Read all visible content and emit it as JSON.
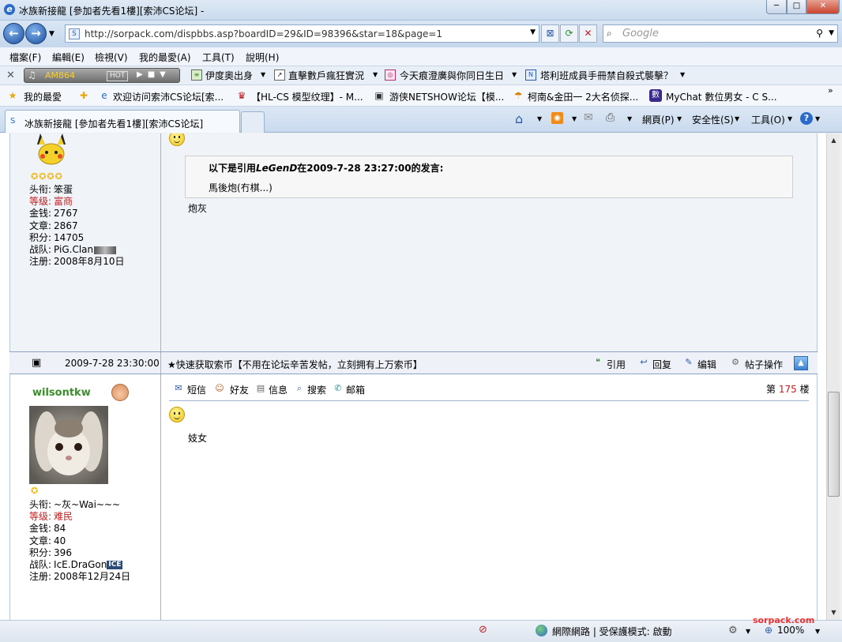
{
  "window": {
    "title": "冰族新接龍 [參加者先看1樓][索沛CS论坛] -",
    "min_label": "─",
    "max_label": "□",
    "close_label": "✕"
  },
  "nav": {
    "url": "http://sorpack.com/dispbbs.asp?boardID=29&ID=98396&star=18&page=1",
    "search_placeholder": "Google"
  },
  "menu": [
    "檔案(F)",
    "編輯(E)",
    "檢視(V)",
    "我的最愛(A)",
    "工具(T)",
    "說明(H)"
  ],
  "toolbar": {
    "radio_station": "AM864",
    "radio_hot": "HOT",
    "links": [
      "伊度奧出身",
      "直擊數戶瘋狂實況",
      "今天痕澄廣與你同日生日",
      "塔利班成員手冊禁自殺式襲擊？"
    ]
  },
  "favorites": {
    "label": "我的最愛",
    "items": [
      "欢迎访问索沛CS论坛[索...",
      "【HL-CS 模型纹理】- M...",
      "游侠NETSHOW论坛【模...",
      "柯南&金田一 2大名侦探...",
      "MyChat 數位男女 - C S..."
    ]
  },
  "tab": {
    "label": "冰族新接龍 [參加者先看1樓][索沛CS论坛]"
  },
  "commands": {
    "page": "網頁(P)",
    "safety": "安全性(S)",
    "tools": "工具(O)"
  },
  "post1": {
    "user": {
      "title_label": "头衔:",
      "title": "笨蛋",
      "level_label": "等级:",
      "level": "富商",
      "money_label": "金钱:",
      "money": "2767",
      "articles_label": "文章:",
      "articles": "2867",
      "points_label": "积分:",
      "points": "14705",
      "team_label": "战队:",
      "team": "PiG.Clan",
      "joined_label": "注册:",
      "joined": "2008年8月10日"
    },
    "quote_head_prefix": "以下是引用",
    "quote_author": "LeGenD",
    "quote_head_suffix": "在2009-7-28 23:27:00的发言:",
    "quote_body": "馬後炮(冇棋...)",
    "reply": "炮灰"
  },
  "postbar": {
    "time": "2009-7-28 23:30:00",
    "promo": "★快速获取索币【不用在论坛辛苦发帖，立刻拥有上万索币】",
    "actions": [
      "引用",
      "回复",
      "编辑",
      "帖子操作"
    ]
  },
  "post2": {
    "username": "wilsontkw",
    "tools": [
      "短信",
      "好友",
      "信息",
      "搜索",
      "邮箱"
    ],
    "floor_prefix": "第",
    "floor_num": "175",
    "floor_suffix": "楼",
    "user": {
      "title_label": "头衔:",
      "title": "~灰~Wai~~~",
      "level_label": "等级:",
      "level": "难民",
      "money_label": "金钱:",
      "money": "84",
      "articles_label": "文章:",
      "articles": "40",
      "points_label": "积分:",
      "points": "396",
      "team_label": "战队:",
      "team": "IcE.DraGon",
      "team_badge": "ICE",
      "joined_label": "注册:",
      "joined": "2008年12月24日"
    },
    "reply": "妓女"
  },
  "status": {
    "zone": "網際網路 | 受保護模式: 啟動",
    "zoom": "100%",
    "watermark": "sorpack.com"
  },
  "colors": {
    "accent": "#2a6ac8",
    "level_red": "#c41e1e",
    "username_green": "#3a8e2a",
    "floor_red": "#c41e1e"
  }
}
